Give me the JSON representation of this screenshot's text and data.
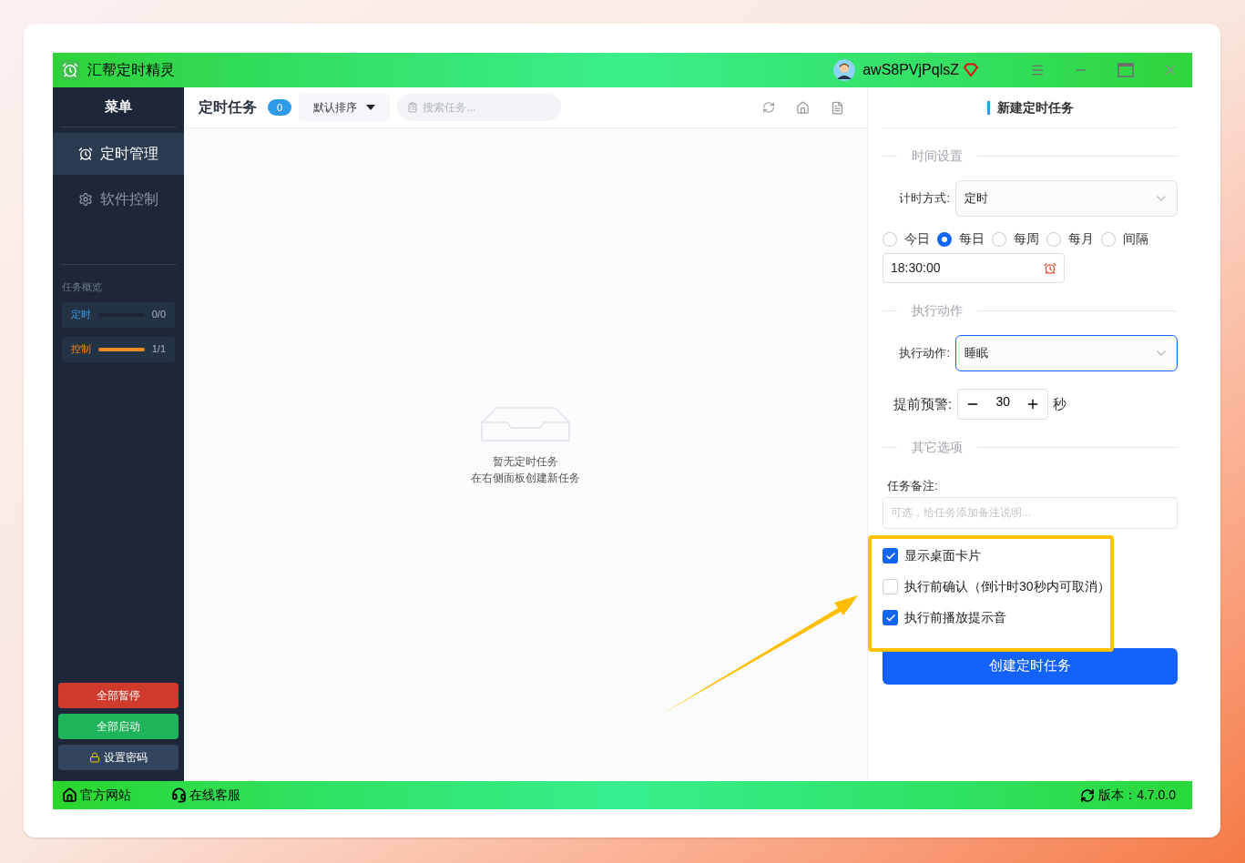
{
  "app": {
    "title": "汇帮定时精灵",
    "user": "awS8PVjPqlsZ"
  },
  "sidebar": {
    "heading": "菜单",
    "items": [
      {
        "label": "定时管理",
        "selected": true,
        "kind": "clock"
      },
      {
        "label": "软件控制",
        "selected": false,
        "kind": "gear"
      }
    ],
    "overview": {
      "title": "任务概览",
      "rows": [
        {
          "label": "定时",
          "kind": "timer",
          "level": 0,
          "count": "0/0"
        },
        {
          "label": "控制",
          "kind": "control",
          "level": 1,
          "count": "1/1"
        }
      ]
    },
    "buttons": [
      {
        "label": "全部暂停",
        "kind": "danger"
      },
      {
        "label": "全部启动",
        "kind": "success"
      },
      {
        "label": "设置密码",
        "kind": "lock"
      }
    ]
  },
  "task_list": {
    "title": "定时任务",
    "count": "0",
    "sort": "默认排序",
    "search": {
      "placeholder": "搜索任务..."
    },
    "empty": [
      "暂无定时任务",
      "在右侧面板创建新任务"
    ]
  },
  "form": {
    "title": "新建定时任务",
    "timing": {
      "section": "时间设置",
      "label": "计时方式:",
      "value": "定时",
      "time": "18:30:00",
      "repeat": [
        {
          "label": "今日",
          "selected": false
        },
        {
          "label": "每日",
          "selected": true
        },
        {
          "label": "每周",
          "selected": false
        },
        {
          "label": "每月",
          "selected": false
        },
        {
          "label": "间隔",
          "selected": false
        }
      ]
    },
    "action": {
      "section": "执行动作",
      "label": "执行动作:",
      "value": "睡眠",
      "focused": true
    },
    "warning": {
      "label": "提前预警:",
      "value": "30",
      "unit": "秒"
    },
    "other": {
      "section": "其它选项",
      "note_label": "任务备注:",
      "note_placeholder": "可选，给任务添加备注说明...",
      "options": [
        {
          "label": "显示桌面卡片",
          "checked": true
        },
        {
          "label": "执行前确认（倒计时30秒内可取消）",
          "checked": false
        },
        {
          "label": "执行前播放提示音",
          "checked": true
        }
      ]
    },
    "submit": "创建定时任务"
  },
  "footer": {
    "links": [
      {
        "label": "官方网站",
        "kind": "home"
      },
      {
        "label": "在线客服",
        "kind": "support"
      }
    ],
    "version": "版本：4.7.0.0"
  }
}
